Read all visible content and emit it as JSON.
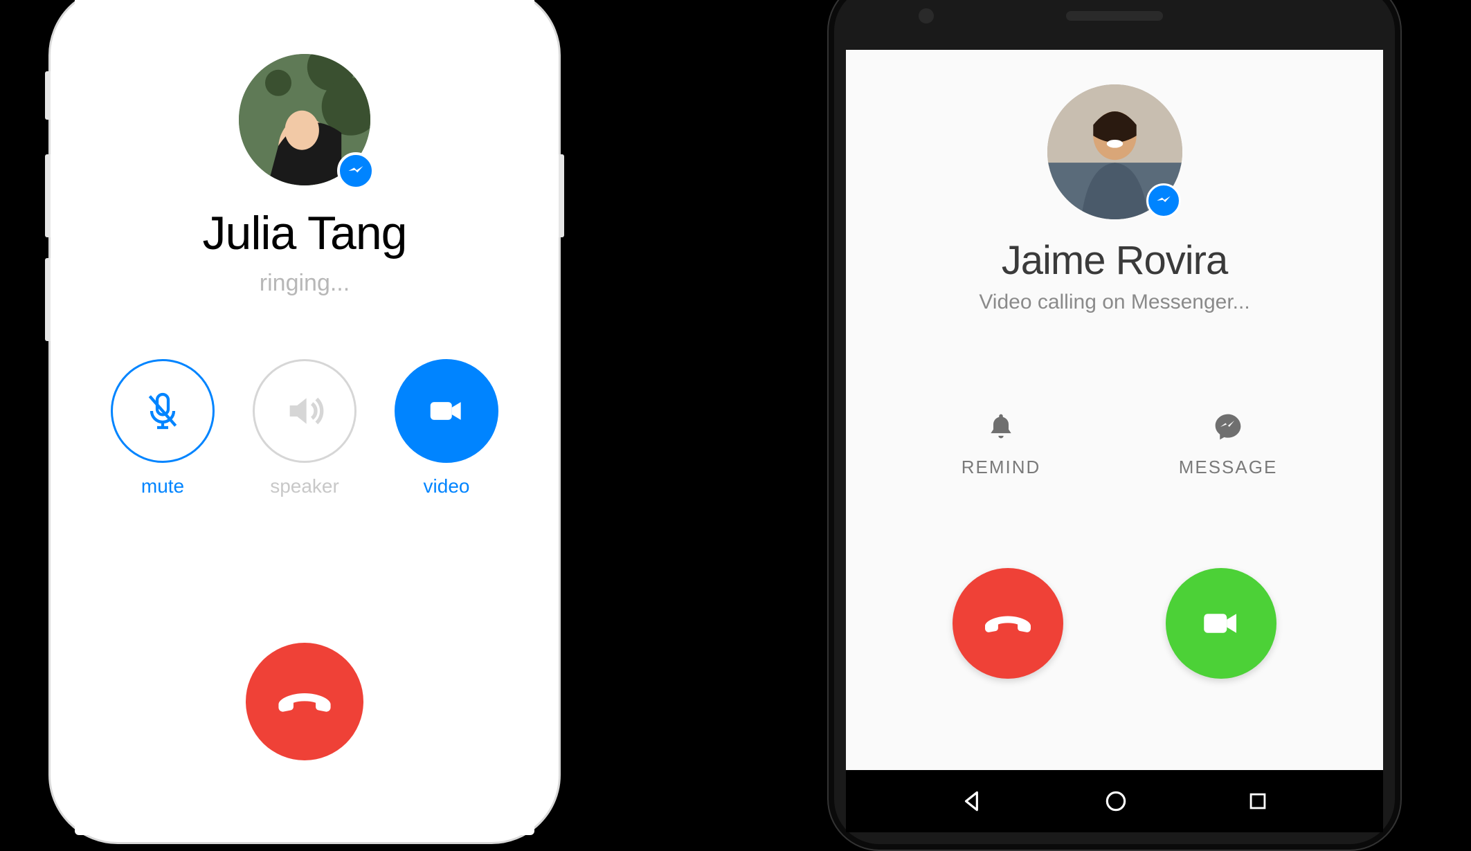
{
  "colors": {
    "accent": "#0084ff",
    "red": "#ef4137",
    "green": "#4cd137",
    "grey_text": "#b7b7b7",
    "grey_border": "#d6d6d6"
  },
  "left_phone": {
    "platform": "iOS",
    "caller_name": "Julia Tang",
    "status": "ringing...",
    "controls": {
      "mute": {
        "label": "mute",
        "active": true
      },
      "speaker": {
        "label": "speaker",
        "active": false
      },
      "video": {
        "label": "video",
        "active": true
      }
    },
    "end_call": {
      "label": "End call"
    }
  },
  "right_phone": {
    "platform": "Android",
    "caller_name": "Jaime Rovira",
    "status": "Video calling on Messenger...",
    "actions": {
      "remind": {
        "label": "REMIND"
      },
      "message": {
        "label": "MESSAGE"
      }
    },
    "decline": {
      "label": "Decline"
    },
    "accept": {
      "label": "Accept video"
    },
    "nav": {
      "back": "Back",
      "home": "Home",
      "recent": "Recent apps"
    }
  }
}
